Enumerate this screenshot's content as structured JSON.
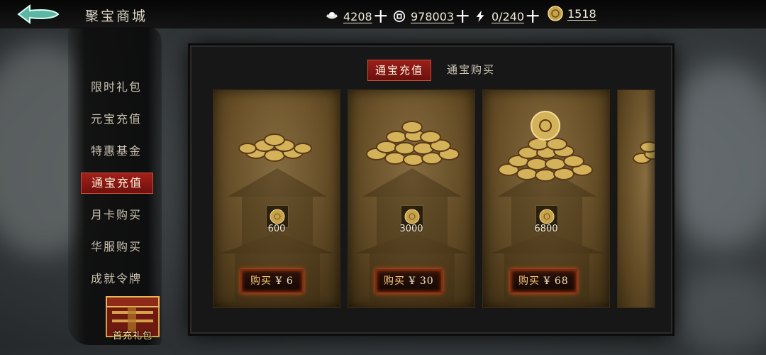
{
  "header": {
    "title": "聚宝商城",
    "resources": [
      {
        "icon": "silver-ingot-icon",
        "value": "4208"
      },
      {
        "icon": "copper-coin-icon",
        "value": "978003"
      },
      {
        "icon": "energy-bolt-icon",
        "value": "0/240"
      },
      {
        "icon": "tongbao-coin-icon",
        "value": "1518"
      }
    ],
    "plus_symbol": "十"
  },
  "sidebar": {
    "items": [
      {
        "label": "限时礼包"
      },
      {
        "label": "元宝充值"
      },
      {
        "label": "特惠基金"
      },
      {
        "label": "通宝充值",
        "active": true
      },
      {
        "label": "月卡购买"
      },
      {
        "label": "华服购买"
      },
      {
        "label": "成就令牌"
      }
    ],
    "gift_label": "首充礼包"
  },
  "tabs": [
    {
      "label": "通宝充值",
      "active": true
    },
    {
      "label": "通宝购买",
      "active": false
    }
  ],
  "products": [
    {
      "amount": "600",
      "buy_label": "购买",
      "currency": "¥",
      "price": "6"
    },
    {
      "amount": "3000",
      "buy_label": "购买",
      "currency": "¥",
      "price": "30"
    },
    {
      "amount": "6800",
      "buy_label": "购买",
      "currency": "¥",
      "price": "68"
    }
  ],
  "colors": {
    "accent_red": "#9c1f19",
    "gold": "#d8b45a",
    "glow": "#e04a16"
  }
}
